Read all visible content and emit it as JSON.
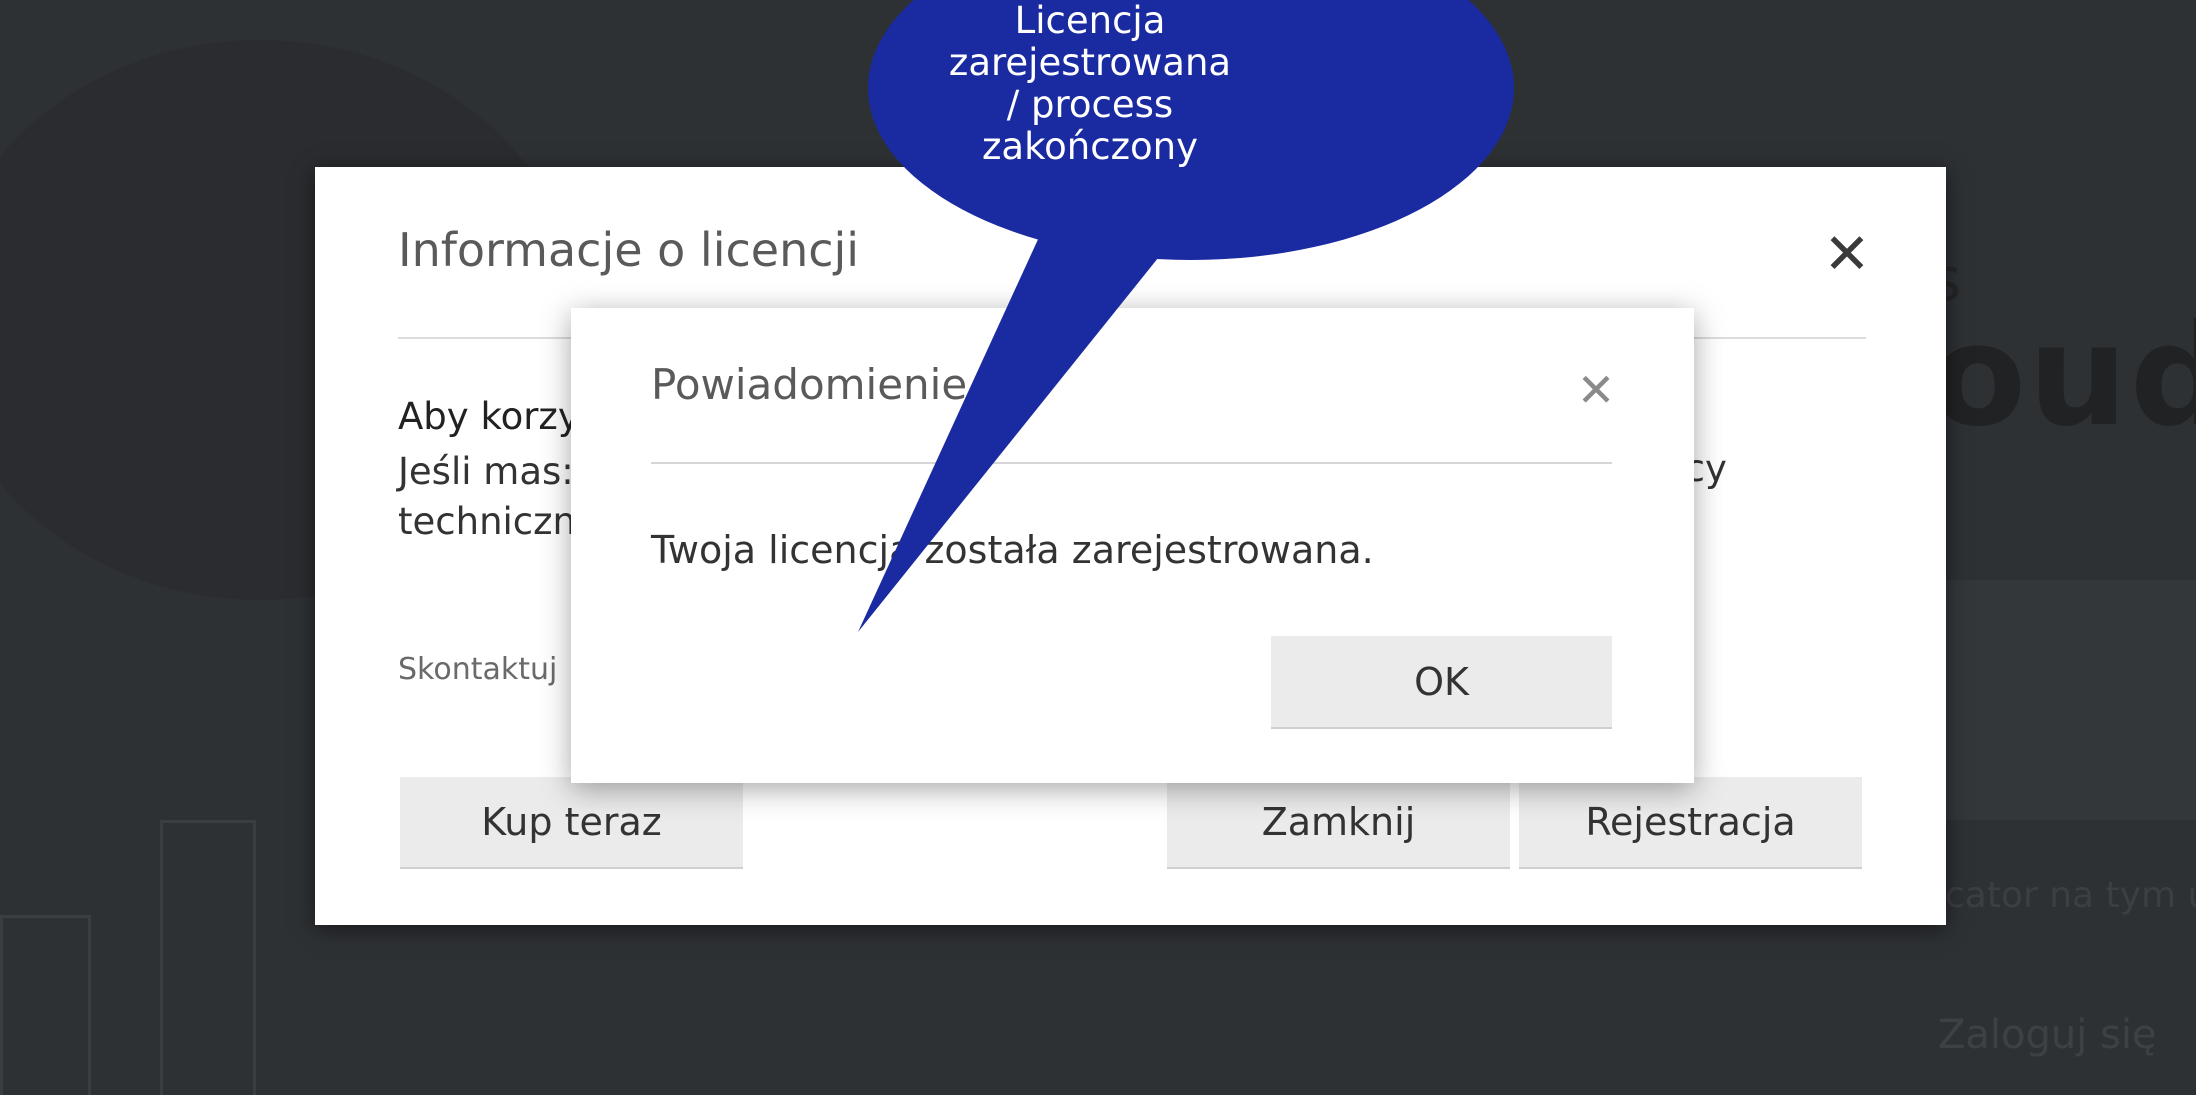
{
  "background": {
    "title": "oud S",
    "hint": "cator na tym u",
    "login_label": "Zaloguj się"
  },
  "license_dialog": {
    "title": "Informacje o licencji",
    "body_head": "Aby korzy",
    "body_line1": "Jeśli mas:",
    "body_line1_tail": "ocy",
    "body_line2": "techniczn",
    "contact": "Skontaktuj",
    "buy_label": "Kup teraz",
    "close_label": "Zamknij",
    "register_label": "Rejestracja"
  },
  "notification_dialog": {
    "title": "Powiadomienie",
    "message": "Twoja licencja została zarejestrowana.",
    "ok_label": "OK"
  },
  "callout": {
    "text": "Licencja zarejestrowana / process zakończony",
    "color": "#1a2aa0"
  },
  "icons": {
    "license_close": "close-icon",
    "notification_close": "close-icon"
  }
}
